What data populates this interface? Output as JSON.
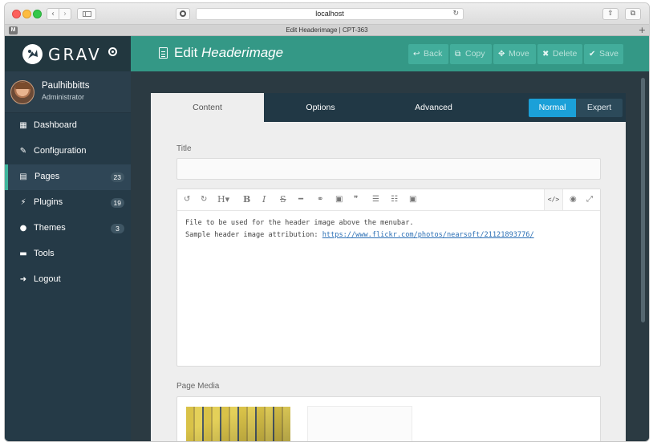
{
  "browser": {
    "url": "localhost",
    "tab_title": "Edit Headerimage | CPT-363",
    "tab_favicon": "M",
    "reload_icon": "reload-icon",
    "share_icon": "share-icon",
    "tabs_icon": "tabs-overview-icon",
    "new_tab_glyph": "+"
  },
  "brand": {
    "name": "GRAV",
    "accent": "#349886",
    "sidebar_bg": "#253a47",
    "active_marker": "#3fb59c"
  },
  "user": {
    "name": "Paulhibbitts",
    "role": "Administrator"
  },
  "sidebar": {
    "items": [
      {
        "label": "Dashboard",
        "icon": "dashboard-grid-icon",
        "glyph": "▦",
        "badge": "",
        "active": false
      },
      {
        "label": "Configuration",
        "icon": "wrench-icon",
        "glyph": "✎",
        "badge": "",
        "active": false
      },
      {
        "label": "Pages",
        "icon": "file-icon",
        "glyph": "▤",
        "badge": "23",
        "active": true
      },
      {
        "label": "Plugins",
        "icon": "plug-icon",
        "glyph": "⚡",
        "badge": "19",
        "active": false
      },
      {
        "label": "Themes",
        "icon": "drop-icon",
        "glyph": "●",
        "badge": "3",
        "active": false
      },
      {
        "label": "Tools",
        "icon": "briefcase-icon",
        "glyph": "▬",
        "badge": "",
        "active": false
      },
      {
        "label": "Logout",
        "icon": "sign-out-icon",
        "glyph": "➜",
        "badge": "",
        "active": false
      }
    ]
  },
  "header": {
    "title_prefix": "Edit",
    "title_page": "Headerimage",
    "actions": {
      "back": "Back",
      "copy": "Copy",
      "move": "Move",
      "delete": "Delete",
      "save": "Save"
    }
  },
  "tabs": {
    "content": "Content",
    "options": "Options",
    "advanced": "Advanced",
    "mode_normal": "Normal",
    "mode_expert": "Expert"
  },
  "form": {
    "title_label": "Title",
    "title_value": "",
    "editor_lines": [
      "File to be used for the header image above the menubar.",
      "Sample header image attribution: "
    ],
    "editor_link": "https://www.flickr.com/photos/nearsoft/21121893776/",
    "media_label": "Page Media"
  },
  "toolbar": {
    "undo": "↺",
    "redo": "↻",
    "heading": "H▾",
    "bold": "B",
    "italic": "I",
    "strike": "S",
    "hr": "━",
    "link": "⚭",
    "image": "▣",
    "quote": "❞",
    "ul": "☰",
    "ol": "☷",
    "youtube": "▣",
    "code": "</>",
    "preview": "◉",
    "fullscreen": "⤢"
  }
}
